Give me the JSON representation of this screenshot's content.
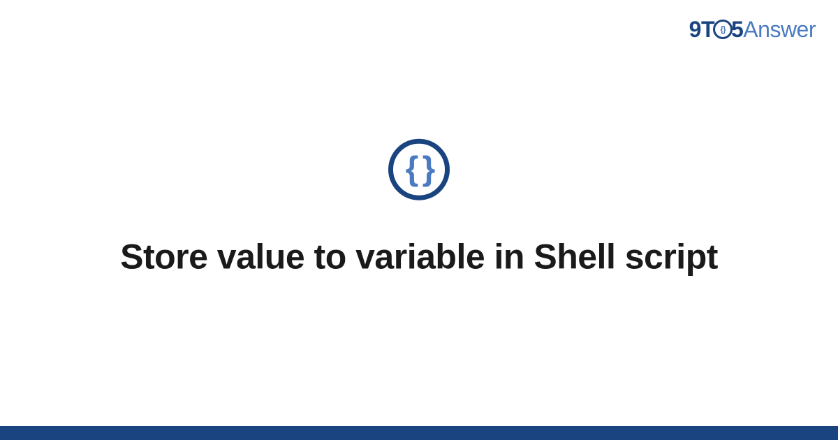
{
  "brand": {
    "part1": "9T",
    "o_inner": "{}",
    "part2": "5",
    "part3": "Answer"
  },
  "category_icon": {
    "glyph": "{ }",
    "semantic": "code-braces"
  },
  "title": "Store value to variable in Shell script",
  "colors": {
    "primary_dark": "#1a4480",
    "primary_light": "#4a7bc0",
    "text": "#1a1a1a",
    "background": "#ffffff"
  }
}
